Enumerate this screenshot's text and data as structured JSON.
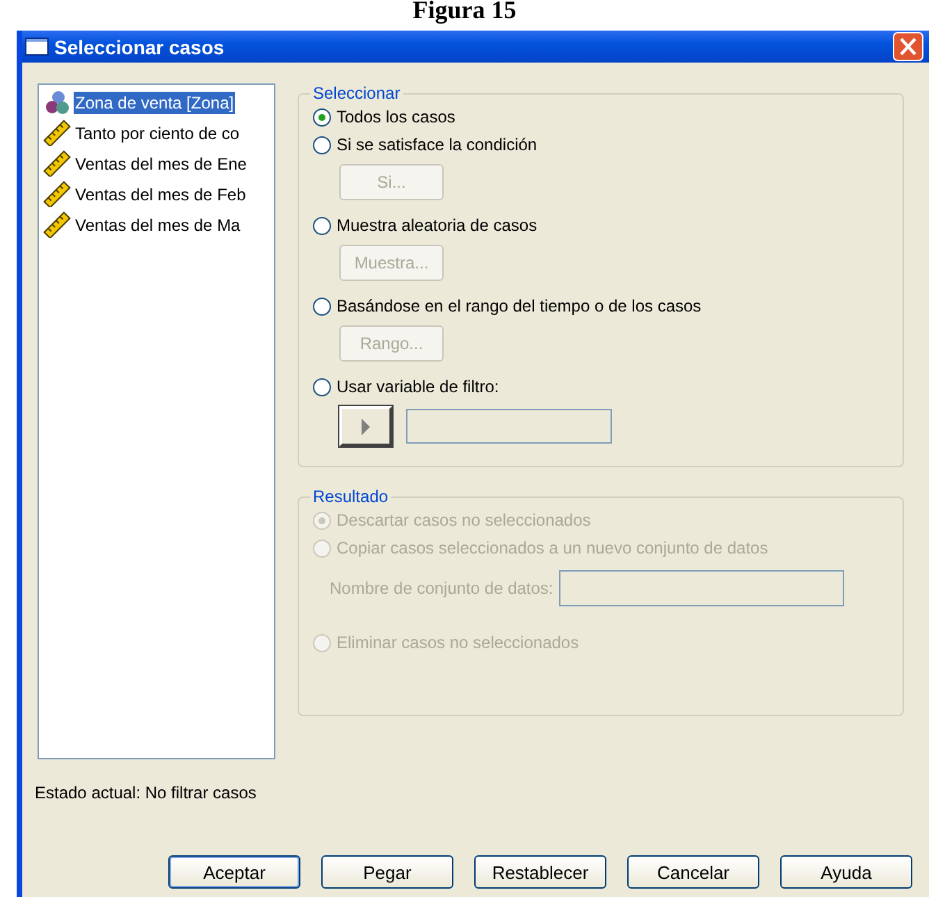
{
  "caption": "Figura 15",
  "window": {
    "title": "Seleccionar casos"
  },
  "variables": [
    {
      "label": "Zona de venta [Zona]",
      "kind": "nominal",
      "selected": true
    },
    {
      "label": "Tanto por ciento de co",
      "kind": "scale",
      "selected": false
    },
    {
      "label": "Ventas del mes de Ene",
      "kind": "scale",
      "selected": false
    },
    {
      "label": "Ventas del mes de Feb",
      "kind": "scale",
      "selected": false
    },
    {
      "label": "Ventas del mes de Ma",
      "kind": "scale",
      "selected": false
    }
  ],
  "select_group": {
    "title": "Seleccionar",
    "options": [
      {
        "label": "Todos los casos",
        "selected": true
      },
      {
        "label": "Si se satisface la condición",
        "selected": false,
        "button": {
          "label": "Si...",
          "disabled": true
        }
      },
      {
        "label": "Muestra aleatoria de casos",
        "selected": false,
        "button": {
          "label": "Muestra...",
          "disabled": true
        }
      },
      {
        "label": "Basándose en el rango del tiempo o de los casos",
        "selected": false,
        "button": {
          "label": "Rango...",
          "disabled": true
        }
      },
      {
        "label": "Usar variable de filtro:",
        "selected": false,
        "filter": true
      }
    ]
  },
  "result_group": {
    "title": "Resultado",
    "disabled": true,
    "options": [
      {
        "label": "Descartar casos no seleccionados",
        "selected": true
      },
      {
        "label": "Copiar casos seleccionados a un nuevo conjunto de datos",
        "selected": false,
        "field_label": "Nombre de conjunto de datos:"
      },
      {
        "label": "Eliminar casos no seleccionados",
        "selected": false
      }
    ]
  },
  "status": "Estado actual: No filtrar casos",
  "buttons": [
    {
      "label": "Aceptar",
      "default": true
    },
    {
      "label": "Pegar",
      "default": false
    },
    {
      "label": "Restablecer",
      "default": false
    },
    {
      "label": "Cancelar",
      "default": false
    },
    {
      "label": "Ayuda",
      "default": false
    }
  ]
}
